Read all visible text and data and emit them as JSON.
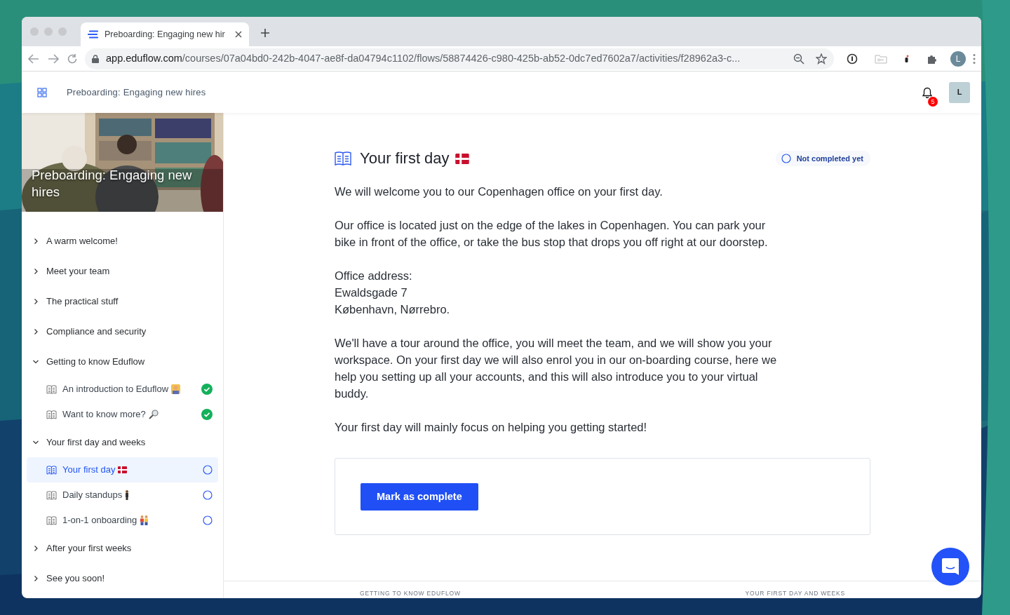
{
  "browser": {
    "tab_title": "Preboarding: Engaging new hir",
    "url_host": "app.eduflow.com",
    "url_path": "/courses/07a04bd0-242b-4047-ae8f-da04794c1102/flows/58874426-c980-425b-ab52-0dc7ed7602a7/activities/f28962a3-c...",
    "profile_initial": "L"
  },
  "header": {
    "course_title": "Preboarding: Engaging new hires",
    "notification_count": "5",
    "avatar_initial": "L"
  },
  "sidebar": {
    "hero_title": "Preboarding: Engaging new hires",
    "sections": [
      {
        "title": "A warm welcome!",
        "expanded": false
      },
      {
        "title": "Meet your team",
        "expanded": false
      },
      {
        "title": "The practical stuff",
        "expanded": false
      },
      {
        "title": "Compliance and security",
        "expanded": false
      },
      {
        "title": "Getting to know Eduflow",
        "expanded": true,
        "children": [
          {
            "title": "An introduction to Eduflow",
            "kind": "teacher",
            "completed": true,
            "selected": false
          },
          {
            "title": "Want to know more?",
            "kind": "magnifier",
            "completed": true,
            "selected": false
          }
        ]
      },
      {
        "title": "Your first day and weeks",
        "expanded": true,
        "children": [
          {
            "title": "Your first day",
            "kind": "flag",
            "completed": false,
            "selected": true
          },
          {
            "title": "Daily standups",
            "kind": "person",
            "completed": false,
            "selected": false
          },
          {
            "title": "1-on-1 onboarding",
            "kind": "pair",
            "completed": false,
            "selected": false
          }
        ]
      },
      {
        "title": "After your first weeks",
        "expanded": false
      },
      {
        "title": "See you soon!",
        "expanded": false
      }
    ]
  },
  "activity": {
    "title": "Your first day",
    "kind": "flag",
    "status": "Not completed yet",
    "completed": false,
    "paragraphs": [
      [
        "We will welcome you to our Copenhagen office on your first day."
      ],
      [
        "Our office is located just on the edge of the lakes in Copenhagen. You can park your bike in front of the office, or take the bus stop that drops you off right at our doorstep."
      ],
      [
        "Office address:",
        "Ewaldsgade 7",
        "København, Nørrebro."
      ],
      [
        "We'll have a tour around the office, you will meet the team, and we will show you your workspace. On your first day we will also enrol you in our on-boarding course, here we help you setting up all your accounts, and this will also introduce you to your virtual buddy."
      ],
      [
        "Your first day will mainly focus on helping you getting started!"
      ]
    ],
    "button": "Mark as complete"
  },
  "footer": {
    "previous": "GETTING TO KNOW EDUFLOW",
    "next": "YOUR FIRST DAY AND WEEKS"
  }
}
